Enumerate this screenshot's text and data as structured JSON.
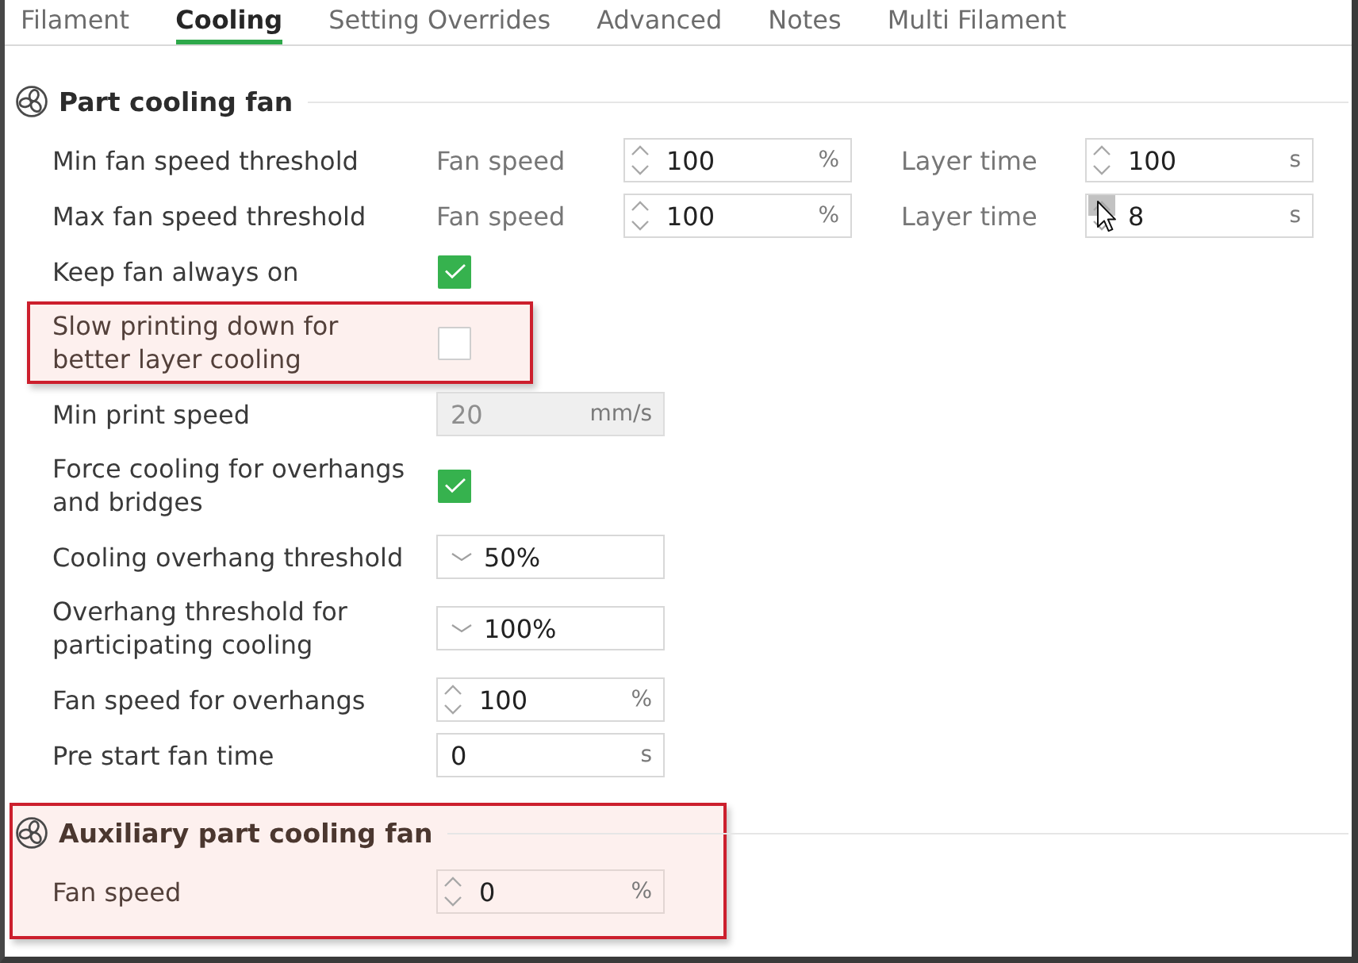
{
  "tabs": [
    {
      "label": "Filament",
      "selected": false
    },
    {
      "label": "Cooling",
      "selected": true
    },
    {
      "label": "Setting Overrides",
      "selected": false
    },
    {
      "label": "Advanced",
      "selected": false
    },
    {
      "label": "Notes",
      "selected": false
    },
    {
      "label": "Multi Filament",
      "selected": false
    }
  ],
  "sections": [
    {
      "title": "Part cooling fan",
      "highlighted": false,
      "rows": [
        {
          "kind": "pair",
          "label": "Min fan speed threshold",
          "highlighted": false,
          "fields": [
            {
              "caption": "Fan speed",
              "kind": "spin",
              "value": "100",
              "unit": "%",
              "disabled": false,
              "hovered": false
            },
            {
              "caption": "Layer time",
              "kind": "spin",
              "value": "100",
              "unit": "s",
              "disabled": false,
              "hovered": false
            }
          ]
        },
        {
          "kind": "pair",
          "label": "Max fan speed threshold",
          "highlighted": false,
          "fields": [
            {
              "caption": "Fan speed",
              "kind": "spin",
              "value": "100",
              "unit": "%",
              "disabled": false,
              "hovered": false
            },
            {
              "caption": "Layer time",
              "kind": "spin",
              "value": "8",
              "unit": "s",
              "disabled": false,
              "hovered": true
            }
          ]
        },
        {
          "kind": "checkbox",
          "label": "Keep fan always on",
          "highlighted": false,
          "checked": true
        },
        {
          "kind": "checkbox",
          "label": "Slow printing down for better layer cooling",
          "highlighted": true,
          "checked": false
        },
        {
          "kind": "field",
          "label": "Min print speed",
          "highlighted": false,
          "fields": [
            {
              "kind": "plain",
              "value": "20",
              "unit": "mm/s",
              "disabled": true,
              "hovered": false
            }
          ]
        },
        {
          "kind": "checkbox",
          "label": "Force cooling for overhangs and bridges",
          "highlighted": false,
          "checked": true
        },
        {
          "kind": "field",
          "label": "Cooling overhang threshold",
          "highlighted": false,
          "fields": [
            {
              "kind": "dropdown",
              "value": "50%",
              "disabled": false,
              "hovered": false
            }
          ]
        },
        {
          "kind": "field",
          "label": "Overhang threshold for participating cooling",
          "highlighted": false,
          "fields": [
            {
              "kind": "dropdown",
              "value": "100%",
              "disabled": false,
              "hovered": false
            }
          ]
        },
        {
          "kind": "field",
          "label": "Fan speed for overhangs",
          "highlighted": false,
          "fields": [
            {
              "kind": "spin",
              "value": "100",
              "unit": "%",
              "disabled": false,
              "hovered": false
            }
          ]
        },
        {
          "kind": "field",
          "label": "Pre start fan time",
          "highlighted": false,
          "fields": [
            {
              "kind": "plain",
              "value": "0",
              "unit": "s",
              "disabled": false,
              "hovered": false
            }
          ]
        }
      ]
    },
    {
      "title": "Auxiliary part cooling fan",
      "highlighted": true,
      "rows": [
        {
          "kind": "field",
          "label": "Fan speed",
          "highlighted": false,
          "fields": [
            {
              "kind": "spin",
              "value": "0",
              "unit": "%",
              "disabled": false,
              "hovered": false
            }
          ]
        }
      ]
    }
  ]
}
